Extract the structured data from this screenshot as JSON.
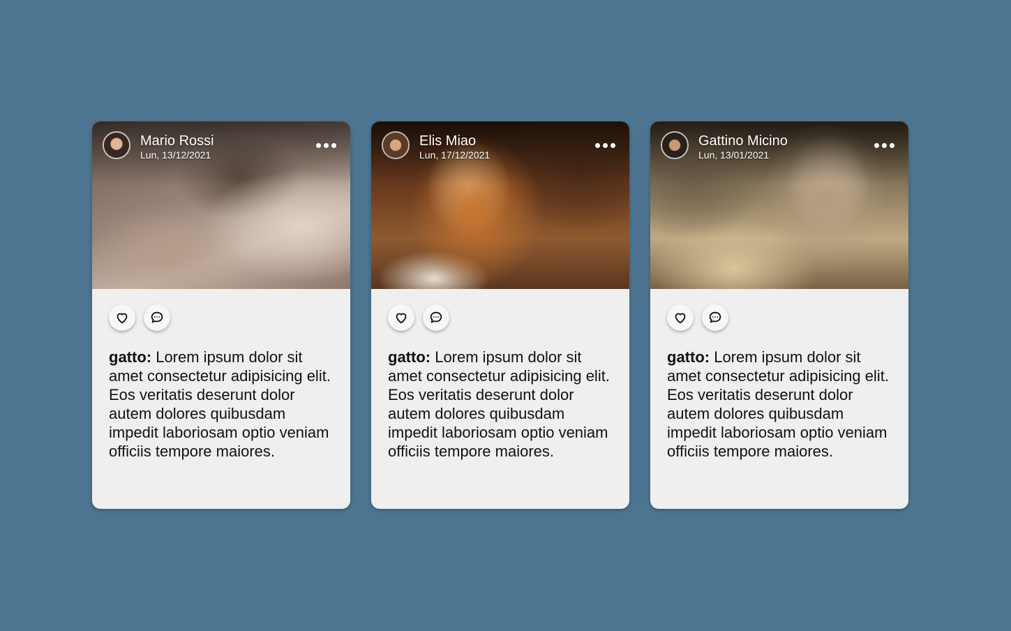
{
  "posts": [
    {
      "author": "Mario Rossi",
      "date": "Lun, 13/12/2021",
      "caption_label": "gatto:",
      "caption_text": " Lorem ipsum dolor sit amet consectetur adipisicing elit. Eos veritatis deserunt dolor autem dolores quibusdam impedit laboriosam optio veniam officiis tempore maiores."
    },
    {
      "author": "Elis Miao",
      "date": "Lun, 17/12/2021",
      "caption_label": "gatto:",
      "caption_text": " Lorem ipsum dolor sit amet consectetur adipisicing elit. Eos veritatis deserunt dolor autem dolores quibusdam impedit laboriosam optio veniam officiis tempore maiores."
    },
    {
      "author": "Gattino Micino",
      "date": "Lun, 13/01/2021",
      "caption_label": "gatto:",
      "caption_text": " Lorem ipsum dolor sit amet consectetur adipisicing elit. Eos veritatis deserunt dolor autem dolores quibusdam impedit laboriosam optio veniam officiis tempore maiores."
    }
  ],
  "icons": {
    "more": "more-horizontal-icon",
    "like": "heart-icon",
    "comment": "comment-icon"
  },
  "colors": {
    "background": "#4d7591",
    "card": "#efefef",
    "text": "#111111"
  }
}
